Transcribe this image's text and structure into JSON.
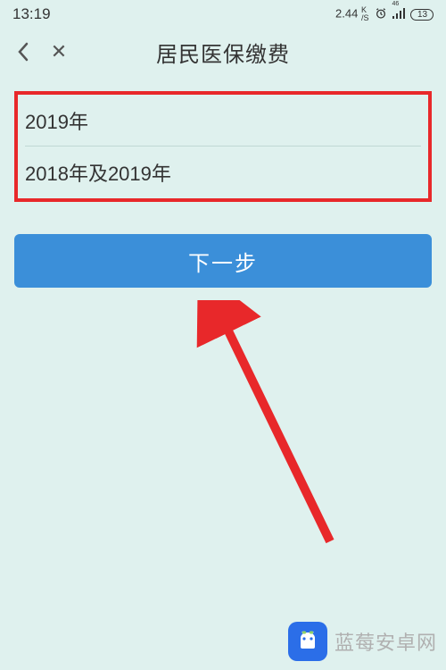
{
  "status": {
    "time": "13:19",
    "speed_value": "2.44",
    "speed_unit_top": "K",
    "speed_unit_bottom": "/S",
    "battery_value": "13",
    "signal_label": "46"
  },
  "nav": {
    "title": "居民医保缴费",
    "close_glyph": "✕"
  },
  "options": [
    {
      "label": "2019年"
    },
    {
      "label": "2018年及2019年"
    }
  ],
  "button": {
    "next_label": "下一步"
  },
  "watermark": {
    "text": "蓝莓安卓网"
  },
  "colors": {
    "accent_blue": "#3b8fd9",
    "highlight_red": "#e8282a",
    "bg": "#dff1ee"
  }
}
